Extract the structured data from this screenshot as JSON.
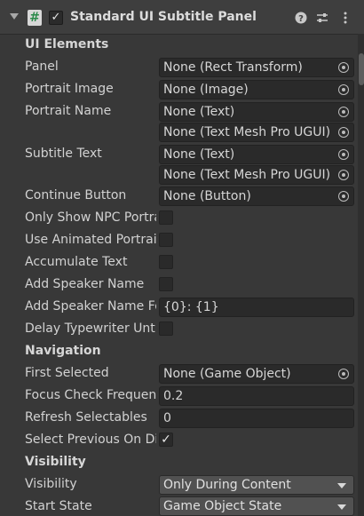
{
  "component": {
    "title": "Standard UI Subtitle Panel",
    "enabled_glyph": "✓",
    "script_glyph": "#",
    "icons": [
      "foldout-arrow-icon",
      "script-icon",
      "help-icon",
      "presets-icon",
      "kebab-menu-icon"
    ]
  },
  "sections": {
    "ui_elements": "UI Elements",
    "navigation": "Navigation",
    "visibility": "Visibility"
  },
  "ui_elements": {
    "panel": {
      "label": "Panel",
      "value": "None (Rect Transform)"
    },
    "portrait_image": {
      "label": "Portrait Image",
      "value": "None (Image)"
    },
    "portrait_name": {
      "label": "Portrait Name",
      "value": "None (Text)",
      "value2": "None (Text Mesh Pro UGUI)"
    },
    "subtitle_text": {
      "label": "Subtitle Text",
      "value": "None (Text)",
      "value2": "None (Text Mesh Pro UGUI)"
    },
    "continue_button": {
      "label": "Continue Button",
      "value": "None (Button)"
    },
    "only_show_npc_portraits": {
      "label": "Only Show NPC Portraits",
      "checked": false
    },
    "use_animated_portraits": {
      "label": "Use Animated Portraits",
      "checked": false
    },
    "accumulate_text": {
      "label": "Accumulate Text",
      "checked": false
    },
    "add_speaker_name": {
      "label": "Add Speaker Name",
      "checked": false
    },
    "add_speaker_name_format": {
      "label": "Add Speaker Name Format",
      "value": "{0}: {1}"
    },
    "delay_typewriter_until_open": {
      "label": "Delay Typewriter Until Open",
      "checked": false
    }
  },
  "navigation": {
    "first_selected": {
      "label": "First Selected",
      "value": "None (Game Object)"
    },
    "focus_check_frequency": {
      "label": "Focus Check Frequency",
      "value": "0.2"
    },
    "refresh_selectables": {
      "label": "Refresh Selectables",
      "value": "0"
    },
    "select_previous_on_disable": {
      "label": "Select Previous On Disable",
      "checked": true,
      "glyph": "✓"
    }
  },
  "visibility": {
    "visibility": {
      "label": "Visibility",
      "value": "Only During Content"
    },
    "start_state": {
      "label": "Start State",
      "value": "Game Object State"
    }
  }
}
